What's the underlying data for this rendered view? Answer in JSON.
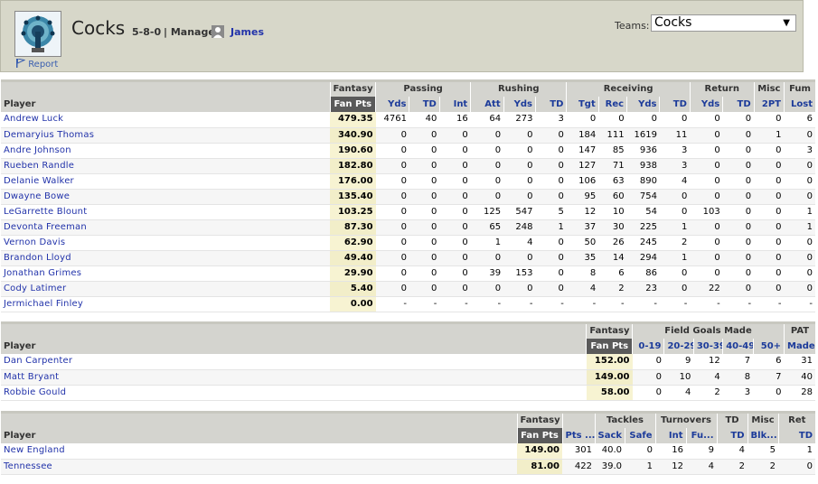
{
  "header": {
    "team_name": "Cocks",
    "record": "5-8-0",
    "manager_label": "| Manager:",
    "manager_name": "James",
    "report_label": "Report",
    "teams_label": "Teams:",
    "teams_selected": "Cocks",
    "logo_icon": "peacock-logo-icon",
    "flag_icon": "flag-icon",
    "user_icon": "user-icon"
  },
  "offense": {
    "groups": [
      "Fantasy",
      "Passing",
      "Rushing",
      "Receiving",
      "Return",
      "Misc",
      "Fum"
    ],
    "columns": [
      "Player",
      "Fan Pts",
      "Yds",
      "TD",
      "Int",
      "Att",
      "Yds",
      "TD",
      "Tgt",
      "Rec",
      "Yds",
      "TD",
      "Yds",
      "TD",
      "2PT",
      "Lost"
    ],
    "rows": [
      [
        "Andrew Luck",
        "479.35",
        "4761",
        "40",
        "16",
        "64",
        "273",
        "3",
        "0",
        "0",
        "0",
        "0",
        "0",
        "0",
        "0",
        "6"
      ],
      [
        "Demaryius Thomas",
        "340.90",
        "0",
        "0",
        "0",
        "0",
        "0",
        "0",
        "184",
        "111",
        "1619",
        "11",
        "0",
        "0",
        "1",
        "0"
      ],
      [
        "Andre Johnson",
        "190.60",
        "0",
        "0",
        "0",
        "0",
        "0",
        "0",
        "147",
        "85",
        "936",
        "3",
        "0",
        "0",
        "0",
        "3"
      ],
      [
        "Rueben Randle",
        "182.80",
        "0",
        "0",
        "0",
        "0",
        "0",
        "0",
        "127",
        "71",
        "938",
        "3",
        "0",
        "0",
        "0",
        "0"
      ],
      [
        "Delanie Walker",
        "176.00",
        "0",
        "0",
        "0",
        "0",
        "0",
        "0",
        "106",
        "63",
        "890",
        "4",
        "0",
        "0",
        "0",
        "0"
      ],
      [
        "Dwayne Bowe",
        "135.40",
        "0",
        "0",
        "0",
        "0",
        "0",
        "0",
        "95",
        "60",
        "754",
        "0",
        "0",
        "0",
        "0",
        "0"
      ],
      [
        "LeGarrette Blount",
        "103.25",
        "0",
        "0",
        "0",
        "125",
        "547",
        "5",
        "12",
        "10",
        "54",
        "0",
        "103",
        "0",
        "0",
        "1"
      ],
      [
        "Devonta Freeman",
        "87.30",
        "0",
        "0",
        "0",
        "65",
        "248",
        "1",
        "37",
        "30",
        "225",
        "1",
        "0",
        "0",
        "0",
        "1"
      ],
      [
        "Vernon Davis",
        "62.90",
        "0",
        "0",
        "0",
        "1",
        "4",
        "0",
        "50",
        "26",
        "245",
        "2",
        "0",
        "0",
        "0",
        "0"
      ],
      [
        "Brandon Lloyd",
        "49.40",
        "0",
        "0",
        "0",
        "0",
        "0",
        "0",
        "35",
        "14",
        "294",
        "1",
        "0",
        "0",
        "0",
        "0"
      ],
      [
        "Jonathan Grimes",
        "29.90",
        "0",
        "0",
        "0",
        "39",
        "153",
        "0",
        "8",
        "6",
        "86",
        "0",
        "0",
        "0",
        "0",
        "0"
      ],
      [
        "Cody Latimer",
        "5.40",
        "0",
        "0",
        "0",
        "0",
        "0",
        "0",
        "4",
        "2",
        "23",
        "0",
        "22",
        "0",
        "0",
        "0"
      ],
      [
        "Jermichael Finley",
        "0.00",
        "-",
        "-",
        "-",
        "-",
        "-",
        "-",
        "-",
        "-",
        "-",
        "-",
        "-",
        "-",
        "-",
        "-"
      ]
    ]
  },
  "kickers": {
    "groups": [
      "Fantasy",
      "Field Goals Made",
      "PAT"
    ],
    "columns": [
      "Player",
      "Fan Pts",
      "0-19",
      "20-29",
      "30-39",
      "40-49",
      "50+",
      "Made"
    ],
    "rows": [
      [
        "Dan Carpenter",
        "152.00",
        "0",
        "9",
        "12",
        "7",
        "6",
        "31"
      ],
      [
        "Matt Bryant",
        "149.00",
        "0",
        "10",
        "4",
        "8",
        "7",
        "40"
      ],
      [
        "Robbie Gould",
        "58.00",
        "0",
        "4",
        "2",
        "3",
        "0",
        "28"
      ]
    ]
  },
  "defense": {
    "groups": [
      "Fantasy",
      "Tackles",
      "Turnovers",
      "TD",
      "Misc",
      "Ret"
    ],
    "columns": [
      "Player",
      "Fan Pts",
      "Pts ...",
      "Sack",
      "Safe",
      "Int",
      "Fu...",
      "TD",
      "Blk...",
      "TD"
    ],
    "rows": [
      [
        "New England",
        "149.00",
        "301",
        "40.0",
        "0",
        "16",
        "9",
        "4",
        "5",
        "1"
      ],
      [
        "Tennessee",
        "81.00",
        "422",
        "39.0",
        "1",
        "12",
        "4",
        "2",
        "2",
        "0"
      ]
    ]
  }
}
